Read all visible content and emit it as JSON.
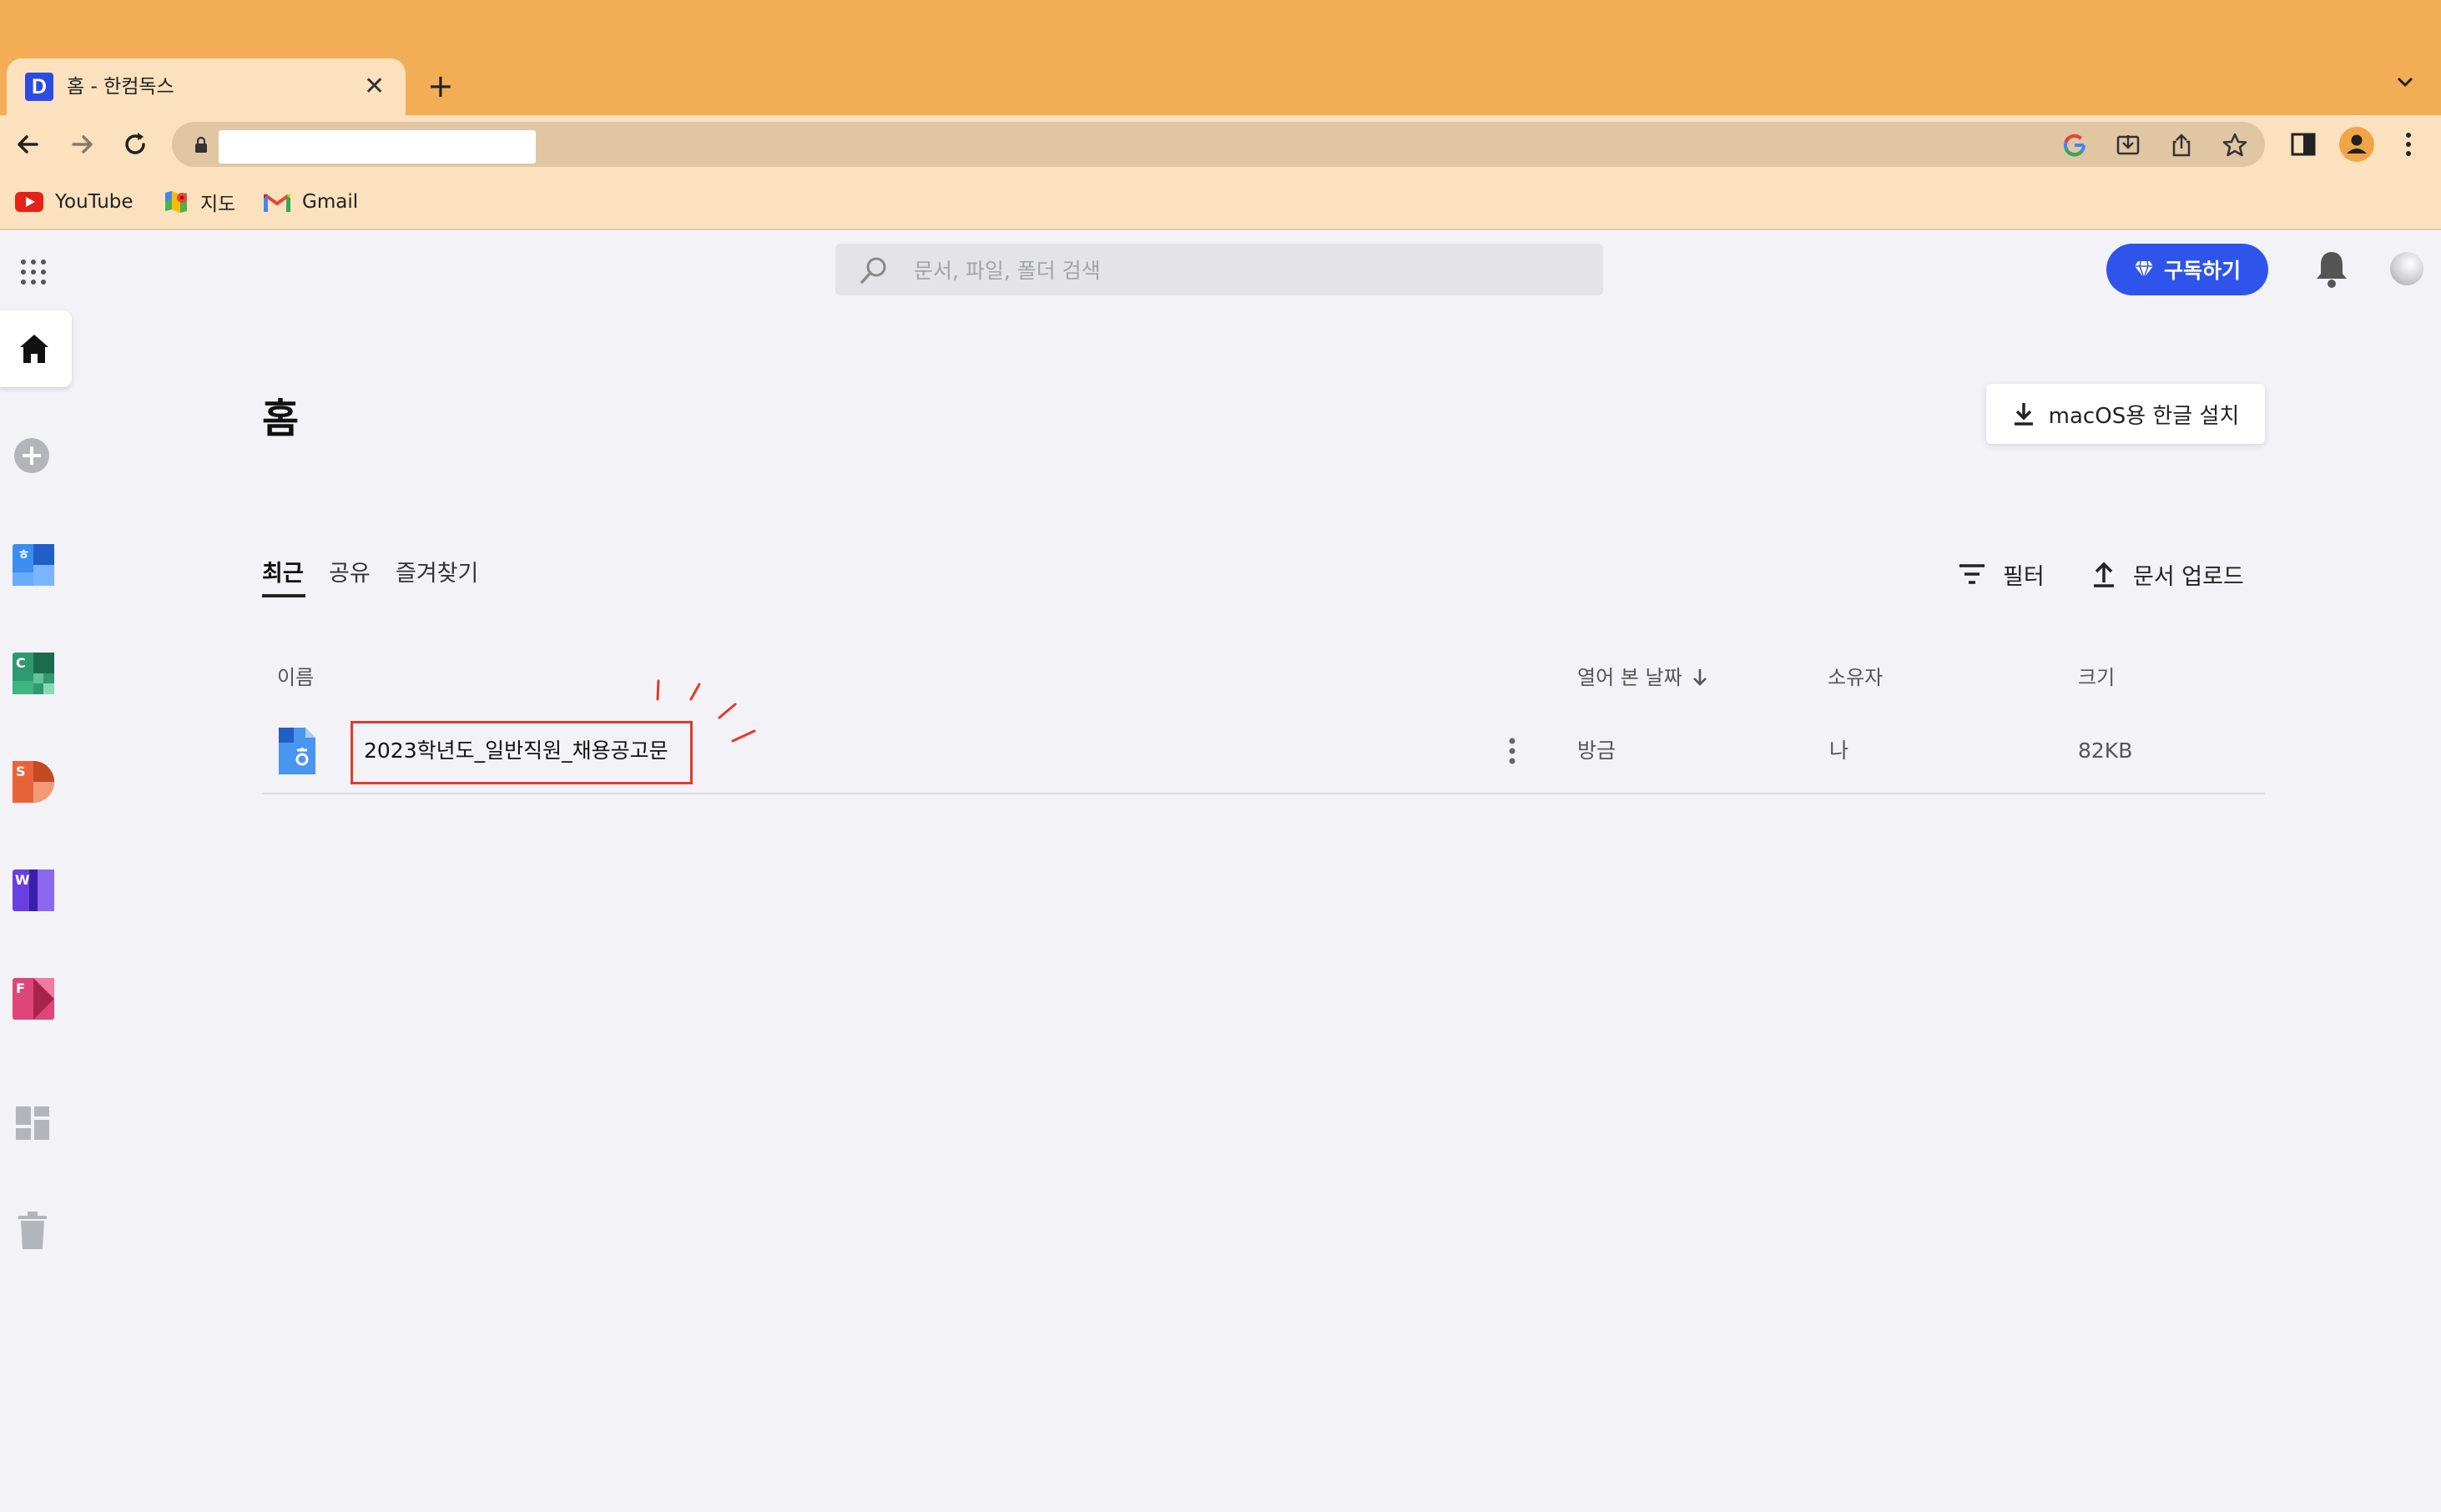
{
  "browser": {
    "tab_title": "홈 - 한컴독스",
    "tab_favicon_letter": "D",
    "bookmarks": [
      {
        "label": "YouTube",
        "icon": "youtube-icon"
      },
      {
        "label": "지도",
        "icon": "maps-icon"
      },
      {
        "label": "Gmail",
        "icon": "gmail-icon"
      }
    ]
  },
  "header": {
    "search_placeholder": "문서, 파일, 폴더 검색",
    "subscribe_label": "구독하기"
  },
  "sidebar": {
    "items": [
      "home-icon",
      "add-icon",
      "hword-app-icon",
      "hcell-app-icon",
      "hshow-app-icon",
      "word-app-icon",
      "pdf-app-icon",
      "templates-icon",
      "trash-icon"
    ],
    "app_letters": {
      "cell": "C",
      "show": "S",
      "word": "W",
      "pdf": "F"
    }
  },
  "main": {
    "title": "홈",
    "install_label": "macOS용 한글 설치",
    "tabs": [
      "최근",
      "공유",
      "즐겨찾기"
    ],
    "active_tab": "최근",
    "filter_label": "필터",
    "upload_label": "문서 업로드",
    "columns": {
      "name": "이름",
      "opened": "열어 본 날짜",
      "owner": "소유자",
      "size": "크기"
    },
    "files": [
      {
        "name": "2023학년도_일반직원_채용공고문",
        "opened": "방금",
        "owner": "나",
        "size": "82KB"
      }
    ]
  },
  "colors": {
    "tabstrip": "#f2ad55",
    "toolbar": "#fbe1bd",
    "accent": "#2f54eb",
    "highlight": "#e23a2b"
  }
}
